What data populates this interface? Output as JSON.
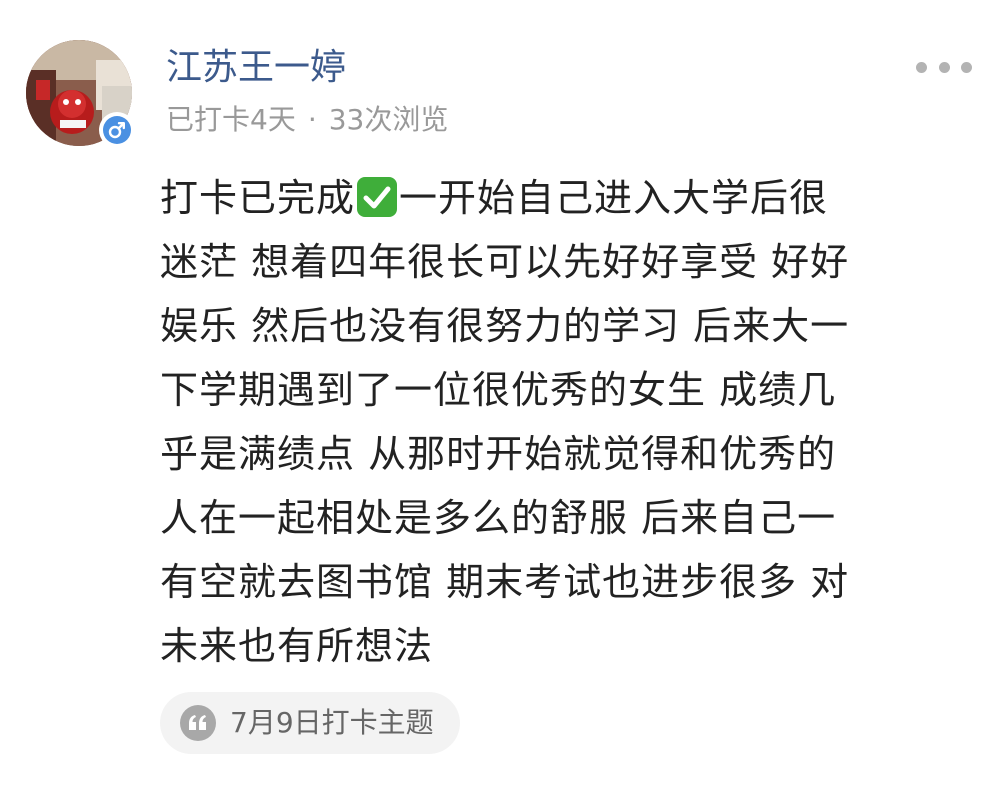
{
  "post": {
    "author": {
      "name": "江苏王一婷",
      "gender_icon": "male-symbol-icon"
    },
    "meta": {
      "checkin_days": "已打卡4天",
      "separator": "·",
      "views": "33次浏览"
    },
    "more_icon": "more-dots-icon",
    "content": {
      "lines": [
        {
          "before": "打卡已完成",
          "emoji": "check-mark-icon",
          "after": "一开始自己进入大学后很"
        },
        {
          "text": "迷茫 想着四年很长可以先好好享受 好好"
        },
        {
          "text": "娱乐 然后也没有很努力的学习 后来大一"
        },
        {
          "text": "下学期遇到了一位很优秀的女生 成绩几"
        },
        {
          "text": "乎是满绩点 从那时开始就觉得和优秀的"
        },
        {
          "text": "人在一起相处是多么的舒服 后来自己一"
        },
        {
          "text": "有空就去图书馆 期末考试也进步很多 对"
        },
        {
          "text": "未来也有所想法"
        }
      ]
    },
    "topic_tag": {
      "icon": "quote-icon",
      "label": "7月9日打卡主题"
    }
  },
  "colors": {
    "username": "#3c5a8c",
    "meta_text": "#999999",
    "body_text": "#222222",
    "gender_badge": "#4a90e2",
    "checkmark_bg": "#3fae3a",
    "tag_bg": "#f3f3f3",
    "tag_text": "#666666"
  }
}
